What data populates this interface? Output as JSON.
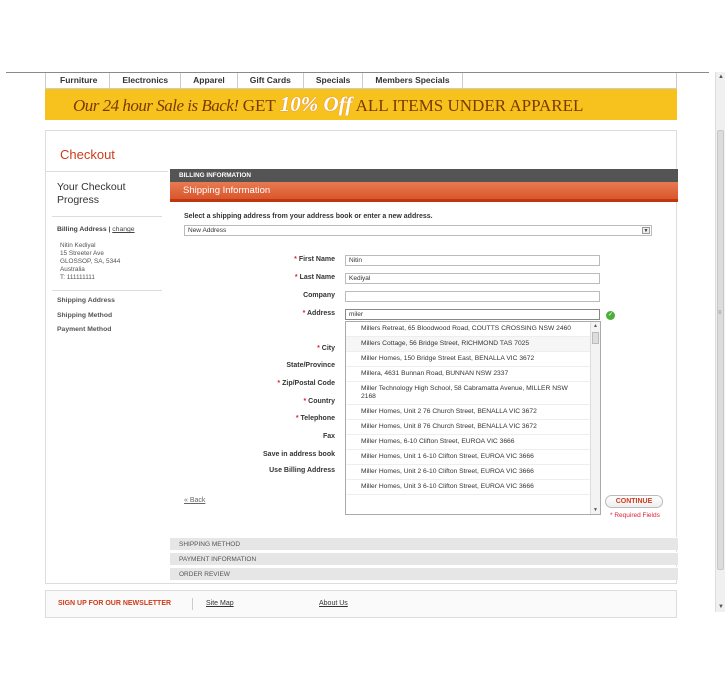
{
  "nav": {
    "items": [
      "Furniture",
      "Electronics",
      "Apparel",
      "Gift Cards",
      "Specials",
      "Members Specials"
    ]
  },
  "banner": {
    "part1": "Our 24 hour Sale is Back!",
    "part2": "GET",
    "part3": "10% Off",
    "part4": "ALL ITEMS UNDER APPAREL"
  },
  "checkout": {
    "title": "Checkout"
  },
  "progress": {
    "title": "Your Checkout Progress",
    "billing_label": "Billing Address |",
    "change_link": "change",
    "address_lines": [
      "Nitin Kediyal",
      "15 Streeter Ave",
      "GLOSSOP, SA, 5344",
      "Australia",
      "T: 111111111"
    ],
    "steps": [
      "Shipping Address",
      "Shipping Method",
      "Payment Method"
    ]
  },
  "sections": {
    "billing": "BILLING INFORMATION",
    "shipping": "Shipping Information",
    "shipping_method": "SHIPPING METHOD",
    "payment": "PAYMENT INFORMATION",
    "review": "ORDER REVIEW"
  },
  "form": {
    "instruction": "Select a shipping address from your address book or enter a new address.",
    "address_select": "New Address",
    "fields": {
      "first_name": {
        "label": "First Name",
        "value": "Nitin",
        "required": "*"
      },
      "last_name": {
        "label": "Last Name",
        "value": "Kediyal",
        "required": "*"
      },
      "company": {
        "label": "Company",
        "value": ""
      },
      "address": {
        "label": "Address",
        "value": "miler",
        "required": "*"
      },
      "city": {
        "label": "City",
        "required": "*"
      },
      "state": {
        "label": "State/Province"
      },
      "zip": {
        "label": "Zip/Postal Code",
        "required": "*"
      },
      "country": {
        "label": "Country",
        "required": "*"
      },
      "telephone": {
        "label": "Telephone",
        "required": "*"
      },
      "fax": {
        "label": "Fax"
      },
      "save": {
        "label": "Save in address book"
      },
      "use_billing": {
        "label": "Use Billing Address"
      }
    },
    "back": "« Back",
    "continue": "CONTINUE",
    "required_note": "* Required Fields"
  },
  "suggestions": [
    "Millers Retreat, 65 Bloodwood Road, COUTTS CROSSING NSW 2460",
    "Millers Cottage, 56 Bridge Street, RICHMOND TAS 7025",
    "Miller Homes, 150 Bridge Street East, BENALLA VIC 3672",
    "Millera, 4631 Bunnan Road, BUNNAN NSW 2337",
    "Miller Technology High School, 58 Cabramatta Avenue, MILLER NSW 2168",
    "Miller Homes, Unit 2 76 Church Street, BENALLA VIC 3672",
    "Miller Homes, Unit 8 76 Church Street, BENALLA VIC 3672",
    "Miller Homes, 6-10 Clifton Street, EUROA VIC 3666",
    "Miller Homes, Unit 1 6-10 Clifton Street, EUROA VIC 3666",
    "Miller Homes, Unit 2 6-10 Clifton Street, EUROA VIC 3666",
    "Miller Homes, Unit 3 6-10 Clifton Street, EUROA VIC 3666"
  ],
  "footer": {
    "newsletter": "SIGN UP FOR OUR NEWSLETTER",
    "sitemap": "Site Map",
    "about": "About Us"
  },
  "colors": {
    "accent": "#cc3c1c",
    "banner": "#f7c21d",
    "billing_bar": "#545454",
    "shipping_bar": "#d9572c"
  }
}
